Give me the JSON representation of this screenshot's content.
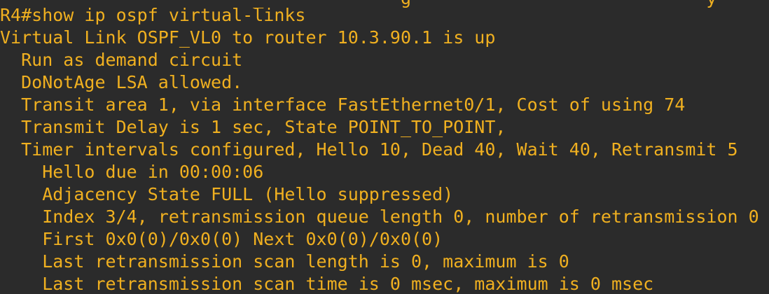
{
  "terminal": {
    "colors": {
      "background": "#2b2b2b",
      "text": "#f0b020"
    },
    "cut_off_top_line": "                        _             g                            y",
    "lines": [
      "R4#show ip ospf virtual-links",
      "Virtual Link OSPF_VL0 to router 10.3.90.1 is up",
      "  Run as demand circuit",
      "  DoNotAge LSA allowed.",
      "  Transit area 1, via interface FastEthernet0/1, Cost of using 74",
      "  Transmit Delay is 1 sec, State POINT_TO_POINT,",
      "  Timer intervals configured, Hello 10, Dead 40, Wait 40, Retransmit 5",
      "    Hello due in 00:00:06",
      "    Adjacency State FULL (Hello suppressed)",
      "    Index 3/4, retransmission queue length 0, number of retransmission 0",
      "    First 0x0(0)/0x0(0) Next 0x0(0)/0x0(0)",
      "    Last retransmission scan length is 0, maximum is 0",
      "    Last retransmission scan time is 0 msec, maximum is 0 msec"
    ]
  }
}
